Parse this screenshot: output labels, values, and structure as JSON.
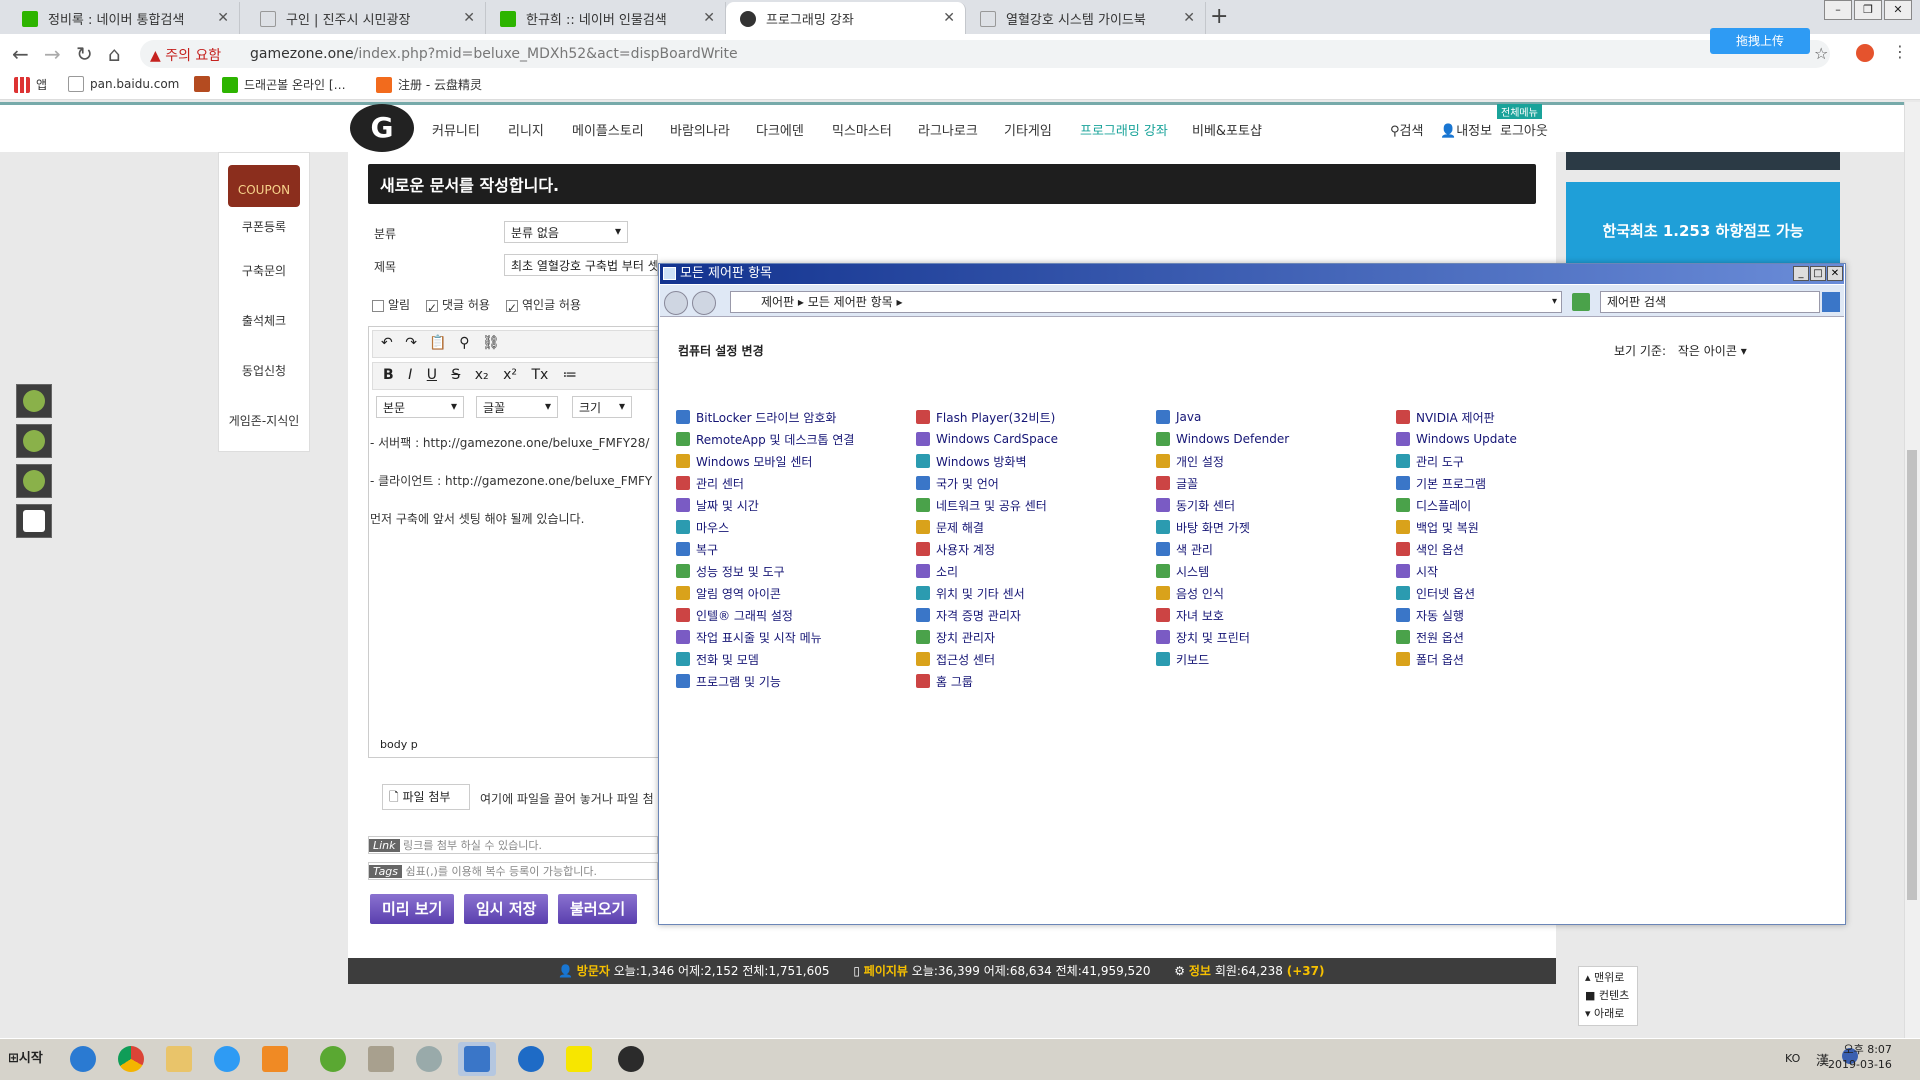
{
  "browser": {
    "tabs": [
      {
        "title": "정비록 : 네이버 통합검색",
        "icon_color": "#2db400"
      },
      {
        "title": "구인 | 진주시 시민광장",
        "icon_color": "#999999"
      },
      {
        "title": "한규희 :: 네이버 인물검색",
        "icon_color": "#2db400"
      },
      {
        "title": "프로그래밍 강좌",
        "icon_color": "#333333",
        "active": true
      },
      {
        "title": "열혈강호 시스템 가이드북",
        "icon_color": "#999999"
      }
    ],
    "security_warning": "주의 요함",
    "url_host": "gamezone.one",
    "url_path": "/index.php?mid=beluxe_MDXh52&act=dispBoardWrite",
    "upload_button": "拖拽上传",
    "bookmarks": [
      "앱",
      "pan.baidu.com",
      "드래곤볼 온라인 […",
      "注册 - 云盘精灵"
    ]
  },
  "site": {
    "menu": [
      "커뮤니티",
      "리니지",
      "메이플스토리",
      "바람의나라",
      "다크에덴",
      "믹스마스터",
      "라그나로크",
      "기타게임",
      "프로그래밍 강좌",
      "비베&포토샵"
    ],
    "menu_active_index": 8,
    "search_label": "검색",
    "myinfo_label": "내정보",
    "logout_label": "로그아웃",
    "new_badge": "전체메뉴",
    "accent_color": "#1aa39a",
    "left_sidebar": {
      "coupon": "COUPON",
      "links": [
        "쿠폰등록",
        "구축문의",
        "출석체크",
        "동업신청",
        "게임존-지식인"
      ]
    },
    "page_heading": "새로운 문서를 작성합니다.",
    "form": {
      "category_label": "분류",
      "category_value": "분류 없음",
      "title_label": "제목",
      "title_value": "최초 열혈강호 구축법 부터 셋팅 까지",
      "notice_label": "알림",
      "comment_label": "댓글 허용",
      "trackback_label": "엮인글 허용"
    },
    "editor": {
      "style_select": "본문",
      "font_select": "글꼴",
      "size_select": "크기",
      "lines": [
        "- 서버팩 : http://gamezone.one/beluxe_FMFY28/",
        "- 클라이언트 : http://gamezone.one/beluxe_FMFY",
        "먼저 구축에 앞서 셋팅 해야 될께 있습니다."
      ],
      "status_path": "body  p"
    },
    "attach_button": "파일 첨부",
    "attach_hint": "여기에 파일을 끌어 놓거나 파일 첨",
    "link_tag": "Link",
    "link_placeholder": "링크를 첨부 하실 수 있습니다.",
    "tags_tag": "Tags",
    "tags_placeholder": "쉼표(,)를 이용해 복수 등록이 가능합니다.",
    "buttons": [
      "미리 보기",
      "임시 저장",
      "불러오기"
    ],
    "footer": {
      "visitor_label": "방문자",
      "visitor_stats": "오늘:1,346 어제:2,152 전체:1,751,605",
      "pageview_label": "페이지뷰",
      "pageview_stats": "오늘:36,399 어제:68,634 전체:41,959,520",
      "info_label": "정보",
      "member_stats": "회원:64,238",
      "member_delta": "(+37)"
    },
    "scroll_nav": [
      "맨위로",
      "컨텐츠",
      "아래로"
    ],
    "ad_text": "한국최초 1.253 하향점프 가능"
  },
  "control_panel": {
    "window_title": "모든 제어판 항목",
    "breadcrumb": "제어판 ▸ 모든 제어판 항목 ▸",
    "search_placeholder": "제어판 검색",
    "heading": "컴퓨터 설정 변경",
    "view_label": "보기 기준:",
    "view_value": "작은 아이콘",
    "columns": [
      [
        "BitLocker 드라이브 암호화",
        "RemoteApp 및 데스크톱 연결",
        "Windows 모바일 센터",
        "관리 센터",
        "날짜 및 시간",
        "마우스",
        "복구",
        "성능 정보 및 도구",
        "알림 영역 아이콘",
        "인텔® 그래픽 설정",
        "작업 표시줄 및 시작 메뉴",
        "전화 및 모뎀",
        "프로그램 및 기능"
      ],
      [
        "Flash Player(32비트)",
        "Windows CardSpace",
        "Windows 방화벽",
        "국가 및 언어",
        "네트워크 및 공유 센터",
        "문제 해결",
        "사용자 계정",
        "소리",
        "위치 및 기타 센서",
        "자격 증명 관리자",
        "장치 관리자",
        "접근성 센터",
        "홈 그룹"
      ],
      [
        "Java",
        "Windows Defender",
        "개인 설정",
        "글꼴",
        "동기화 센터",
        "바탕 화면 가젯",
        "색 관리",
        "시스템",
        "음성 인식",
        "자녀 보호",
        "장치 및 프린터",
        "키보드"
      ],
      [
        "NVIDIA 제어판",
        "Windows Update",
        "관리 도구",
        "기본 프로그램",
        "디스플레이",
        "백업 및 복원",
        "색인 옵션",
        "시작",
        "인터넷 옵션",
        "자동 실행",
        "전원 옵션",
        "폴더 옵션"
      ]
    ]
  },
  "taskbar": {
    "start_label": "시작",
    "ime": "KO",
    "ime_han": "漢",
    "time": "오후 8:07",
    "date": "2019-03-16"
  }
}
